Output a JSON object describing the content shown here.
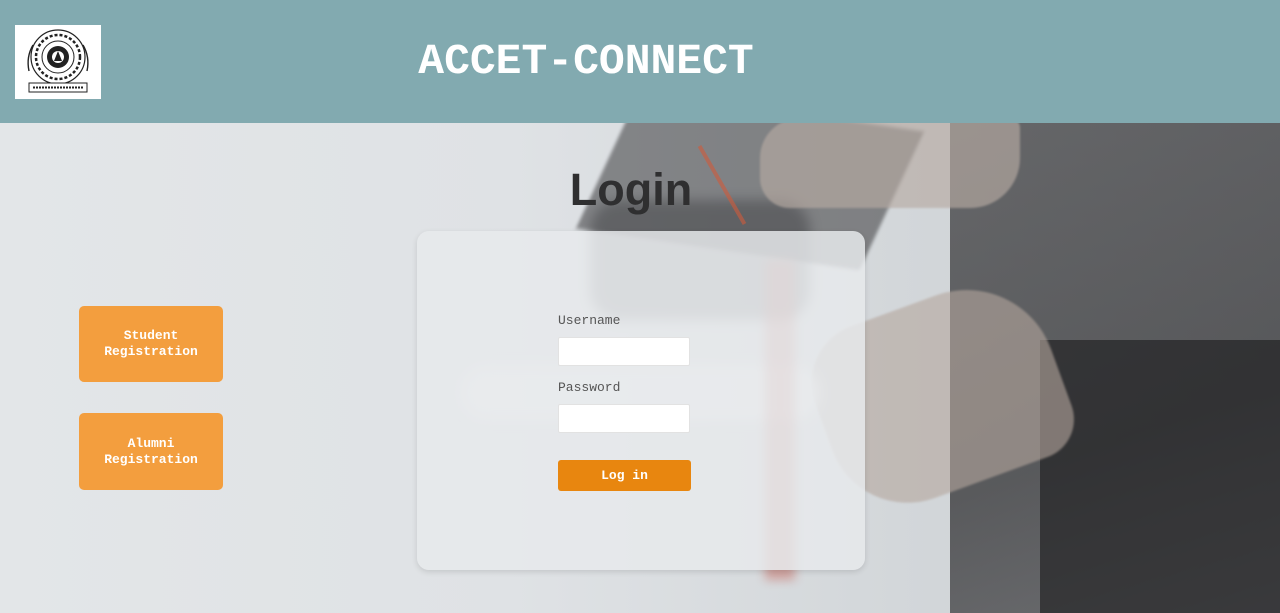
{
  "header": {
    "title": "ACCET-CONNECT",
    "logo_icon": "college-emblem-icon",
    "background_color": "#82aab0"
  },
  "login": {
    "heading": "Login",
    "username_label": "Username",
    "username_value": "",
    "password_label": "Password",
    "password_value": "",
    "submit_label": "Log in"
  },
  "registration": {
    "student_label": "Student Registration",
    "alumni_label": "Alumni Registration",
    "button_color": "#f39e3e"
  },
  "colors": {
    "accent": "#e8860f",
    "heading_text": "#2f2f30"
  }
}
